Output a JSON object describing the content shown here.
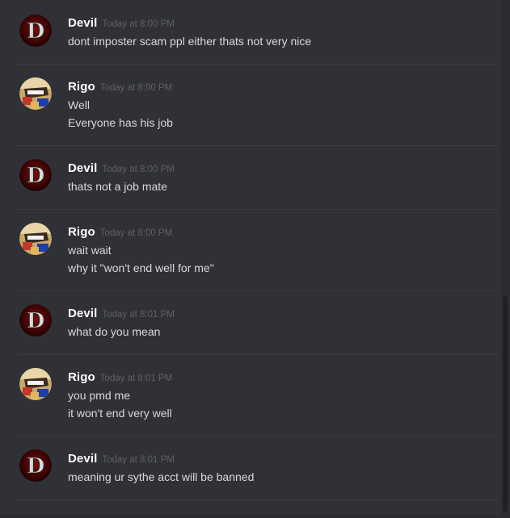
{
  "messages": [
    {
      "username": "Devil",
      "timestamp": "Today at 8:00 PM",
      "avatar": "devil-logo-avatar",
      "lines": [
        "dont imposter scam ppl either thats not very nice"
      ]
    },
    {
      "username": "Rigo",
      "timestamp": "Today at 8:00 PM",
      "avatar": "rigo-character-avatar",
      "lines": [
        "Well",
        "Everyone has his job"
      ]
    },
    {
      "username": "Devil",
      "timestamp": "Today at 8:00 PM",
      "avatar": "devil-logo-avatar",
      "lines": [
        "thats not a job mate"
      ]
    },
    {
      "username": "Rigo",
      "timestamp": "Today at 8:00 PM",
      "avatar": "rigo-character-avatar",
      "lines": [
        "wait wait",
        "why it \"won't end well for me\""
      ]
    },
    {
      "username": "Devil",
      "timestamp": "Today at 8:01 PM",
      "avatar": "devil-logo-avatar",
      "lines": [
        "what do you mean"
      ]
    },
    {
      "username": "Rigo",
      "timestamp": "Today at 8:01 PM",
      "avatar": "rigo-character-avatar",
      "lines": [
        "you pmd me",
        "it won't end very well"
      ]
    },
    {
      "username": "Devil",
      "timestamp": "Today at 8:01 PM",
      "avatar": "devil-logo-avatar",
      "lines": [
        "meaning ur sythe acct will be banned"
      ]
    }
  ],
  "colors": {
    "background": "#2f3136",
    "username": "#ffffff",
    "timestamp": "#5e6065",
    "message_text": "#d8d9da",
    "divider": "#393b40"
  }
}
